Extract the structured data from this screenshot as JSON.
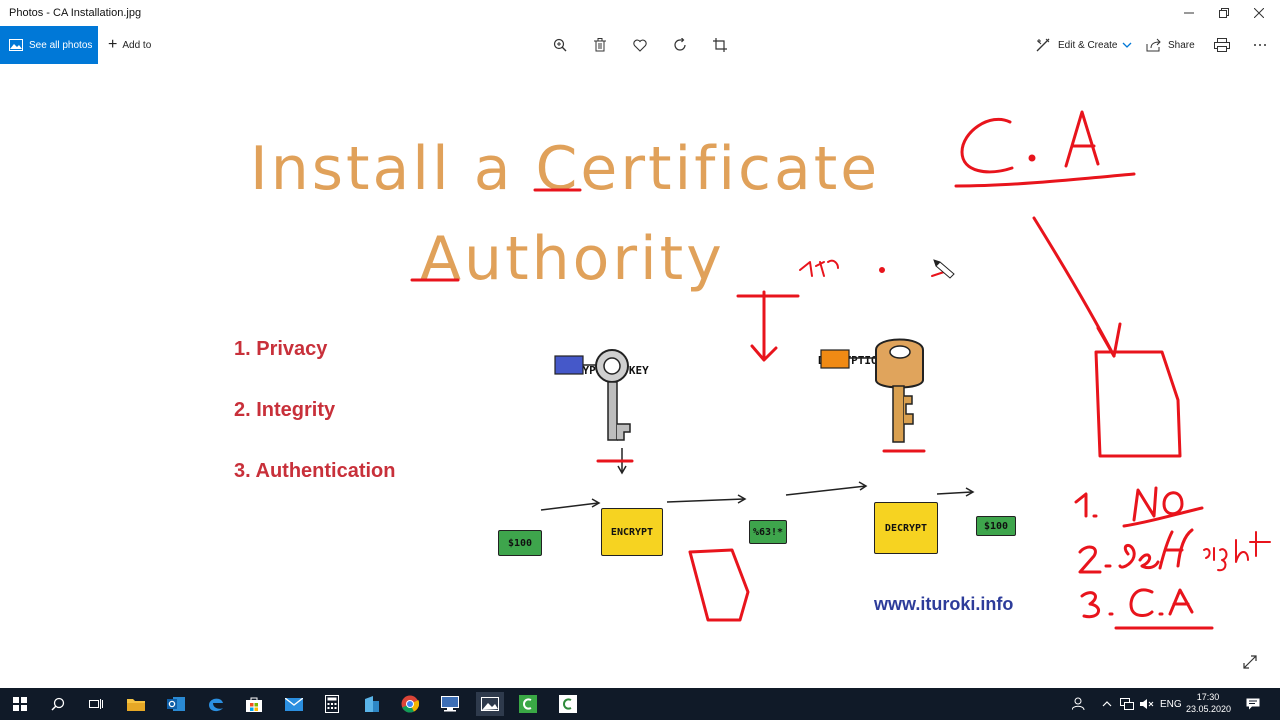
{
  "window": {
    "title": "Photos - CA Installation.jpg"
  },
  "toolbar": {
    "see_all_label": "See all photos",
    "add_to_label": "Add to",
    "edit_create_label": "Edit & Create",
    "share_label": "Share"
  },
  "slide": {
    "title_line1": "Install a Certificate",
    "title_line2": "Authority",
    "bullets": [
      "1. Privacy",
      "2. Integrity",
      "3. Authentication"
    ],
    "encryption_key_label": "ENCRYPTION KEY",
    "decryption_key_label": "DECRYPTION KEY",
    "plaintext": "$100",
    "encrypt_label": "ENCRYPT",
    "ciphertext": "%63!*",
    "decrypt_label": "DECRYPT",
    "result": "$100",
    "url": "www.ituroki.info"
  },
  "annotations": {
    "ca": "C. A",
    "item1": "1. NO",
    "item2": "2. self sight",
    "item3": "3. C.A"
  },
  "taskbar": {
    "language": "ENG",
    "time": "17:30",
    "date": "23.05.2020"
  },
  "colors": {
    "accent": "#0078d7",
    "title_orange": "#e0a15a",
    "bullet_red": "#c8303a",
    "url_blue": "#2d3c9a",
    "pen_red": "#e8141c",
    "taskbar": "#101a28"
  }
}
